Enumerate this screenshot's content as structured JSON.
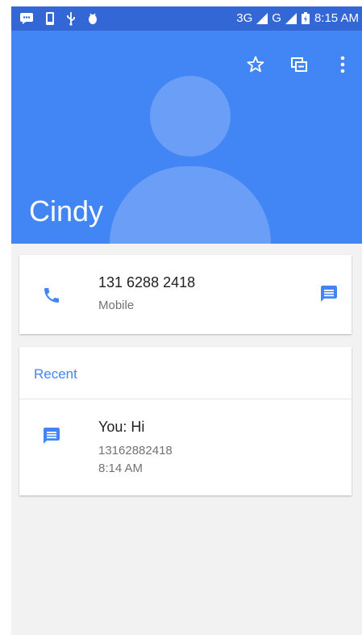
{
  "status_bar": {
    "network_1": "3G",
    "network_2": "G",
    "time": "8:15 AM"
  },
  "header": {
    "contact_name": "Cindy",
    "actions": [
      {
        "icon": "star-outline-icon"
      },
      {
        "icon": "edit-icon"
      },
      {
        "icon": "more-vert-icon"
      }
    ]
  },
  "phone_card": {
    "number": "131 6288 2418",
    "type": "Mobile",
    "left_icon": "phone-icon",
    "right_icon": "message-icon"
  },
  "recent": {
    "title": "Recent",
    "items": [
      {
        "message": "You: Hi",
        "number": "13162882418",
        "time": "8:14 AM",
        "icon": "message-icon"
      }
    ]
  },
  "colors": {
    "header": "#4285f4",
    "status_bar": "#3367d6",
    "accent": "#4285f4",
    "background": "#f2f2f2"
  }
}
